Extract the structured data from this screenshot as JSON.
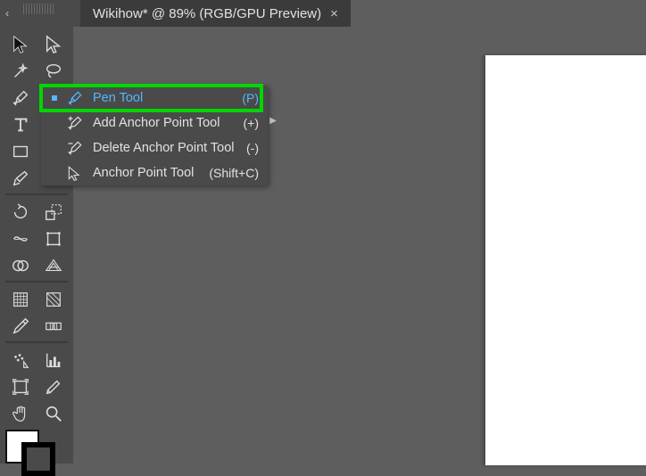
{
  "header": {
    "collapse_glyph": "‹‹",
    "doc_title": "Wikihow* @ 89% (RGB/GPU Preview)",
    "close_glyph": "×"
  },
  "flyout": {
    "items": [
      {
        "label": "Pen Tool",
        "shortcut": "(P)",
        "active": true,
        "icon": "pen"
      },
      {
        "label": "Add Anchor Point Tool",
        "shortcut": "(+)",
        "active": false,
        "icon": "pen-plus"
      },
      {
        "label": "Delete Anchor Point Tool",
        "shortcut": "(-)",
        "active": false,
        "icon": "pen-minus"
      },
      {
        "label": "Anchor Point Tool",
        "shortcut": "(Shift+C)",
        "active": false,
        "icon": "anchor-convert"
      }
    ],
    "expand_glyph": "▶"
  },
  "tools": [
    [
      "selection",
      "direct-selection"
    ],
    [
      "magic-wand",
      "lasso"
    ],
    [
      "pen",
      "curvature"
    ],
    [
      "type",
      "line-segment"
    ],
    [
      "rectangle",
      "paintbrush"
    ],
    [
      "shaper",
      "eraser"
    ],
    [],
    [
      "rotate",
      "scale"
    ],
    [
      "width",
      "free-transform"
    ],
    [
      "shape-builder",
      "perspective-grid"
    ],
    [],
    [
      "mesh",
      "gradient"
    ],
    [
      "eyedropper",
      "blend"
    ],
    [],
    [
      "symbol-sprayer",
      "column-graph"
    ],
    [
      "artboard",
      "slice"
    ],
    [
      "hand",
      "zoom"
    ]
  ]
}
